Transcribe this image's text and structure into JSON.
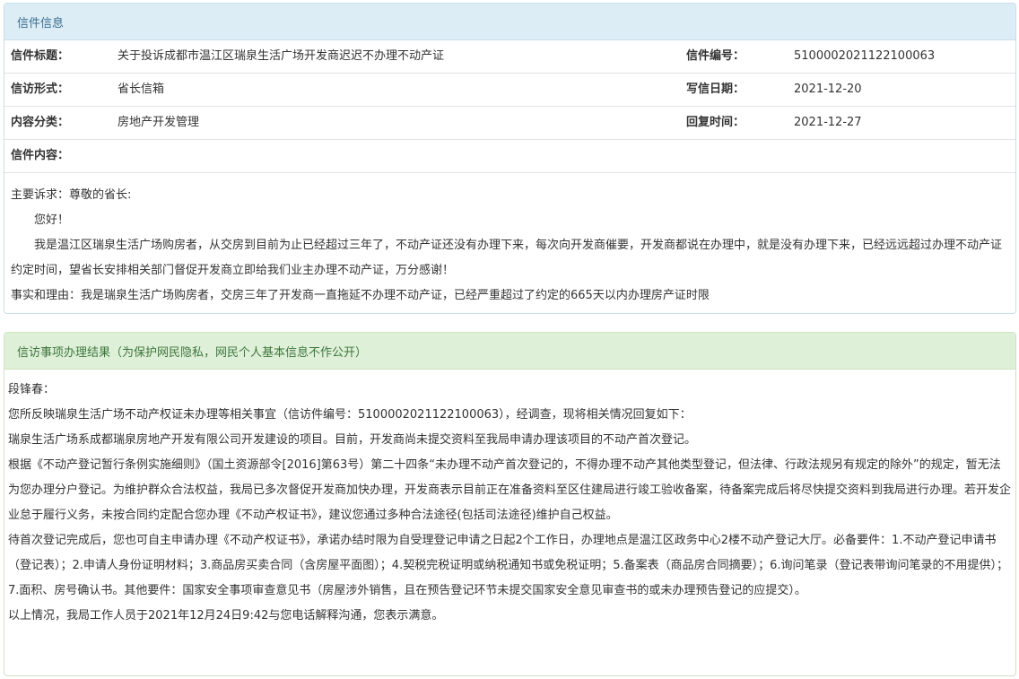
{
  "letter_panel": {
    "heading": "信件信息",
    "rows": [
      [
        {
          "label": "信件标题：",
          "value": "关于投诉成都市温江区瑞泉生活广场开发商迟迟不办理不动产证"
        },
        {
          "label": "信件编号：",
          "value": "5100002021122100063"
        }
      ],
      [
        {
          "label": "信访形式：",
          "value": "省长信箱"
        },
        {
          "label": "写信日期：",
          "value": "2021-12-20"
        }
      ],
      [
        {
          "label": "内容分类：",
          "value": "房地产开发管理"
        },
        {
          "label": "回复时间：",
          "value": "2021-12-27"
        }
      ]
    ],
    "content_label": "信件内容：",
    "content": [
      "主要诉求：尊敬的省长:",
      "您好！",
      "我是温江区瑞泉生活广场购房者，从交房到目前为止已经超过三年了，不动产证还没有办理下来，每次向开发商催要，开发商都说在办理中，就是没有办理下来，已经远远超过办理不动产证约定时间，望省长安排相关部门督促开发商立即给我们业主办理不动产证，万分感谢！",
      "事实和理由：我是瑞泉生活广场购房者，交房三年了开发商一直拖延不办理不动产证，已经严重超过了约定的665天以内办理房产证时限"
    ]
  },
  "result_panel": {
    "heading": "信访事项办理结果（为保护网民隐私，网民个人基本信息不作公开）",
    "paragraphs": [
      "段锋春：",
      "您所反映瑞泉生活广场不动产权证未办理等相关事宜（信访件编号：5100002021122100063），经调查，现将相关情况回复如下：",
      "瑞泉生活广场系成都瑞泉房地产开发有限公司开发建设的项目。目前，开发商尚未提交资料至我局申请办理该项目的不动产首次登记。",
      "根据《不动产登记暂行条例实施细则》（国土资源部令[2016]第63号）第二十四条“未办理不动产首次登记的，不得办理不动产其他类型登记，但法律、行政法规另有规定的除外”的规定，暂无法为您办理分户登记。为维护群众合法权益，我局已多次督促开发商加快办理，开发商表示目前正在准备资料至区住建局进行竣工验收备案，待备案完成后将尽快提交资料到我局进行办理。若开发企业怠于履行义务，未按合同约定配合您办理《不动产权证书》，建议您通过多种合法途径(包括司法途径)维护自己权益。",
      "待首次登记完成后，您也可自主申请办理《不动产权证书》，承诺办结时限为自受理登记申请之日起2个工作日，办理地点是温江区政务中心2楼不动产登记大厅。必备要件：1.不动产登记申请书（登记表）；2.申请人身份证明材料；3.商品房买卖合同（含房屋平面图）；4.契税完税证明或纳税通知书或免税证明；5.备案表（商品房合同摘要）；6.询问笔录（登记表带询问笔录的不用提供）；7.面积、房号确认书。其他要件：国家安全事项审查意见书（房屋涉外销售，且在预告登记环节未提交国家安全意见审查书的或未办理预告登记的应提交）。",
      "以上情况，我局工作人员于2021年12月24日9:42与您电话解释沟通，您表示满意。"
    ]
  }
}
